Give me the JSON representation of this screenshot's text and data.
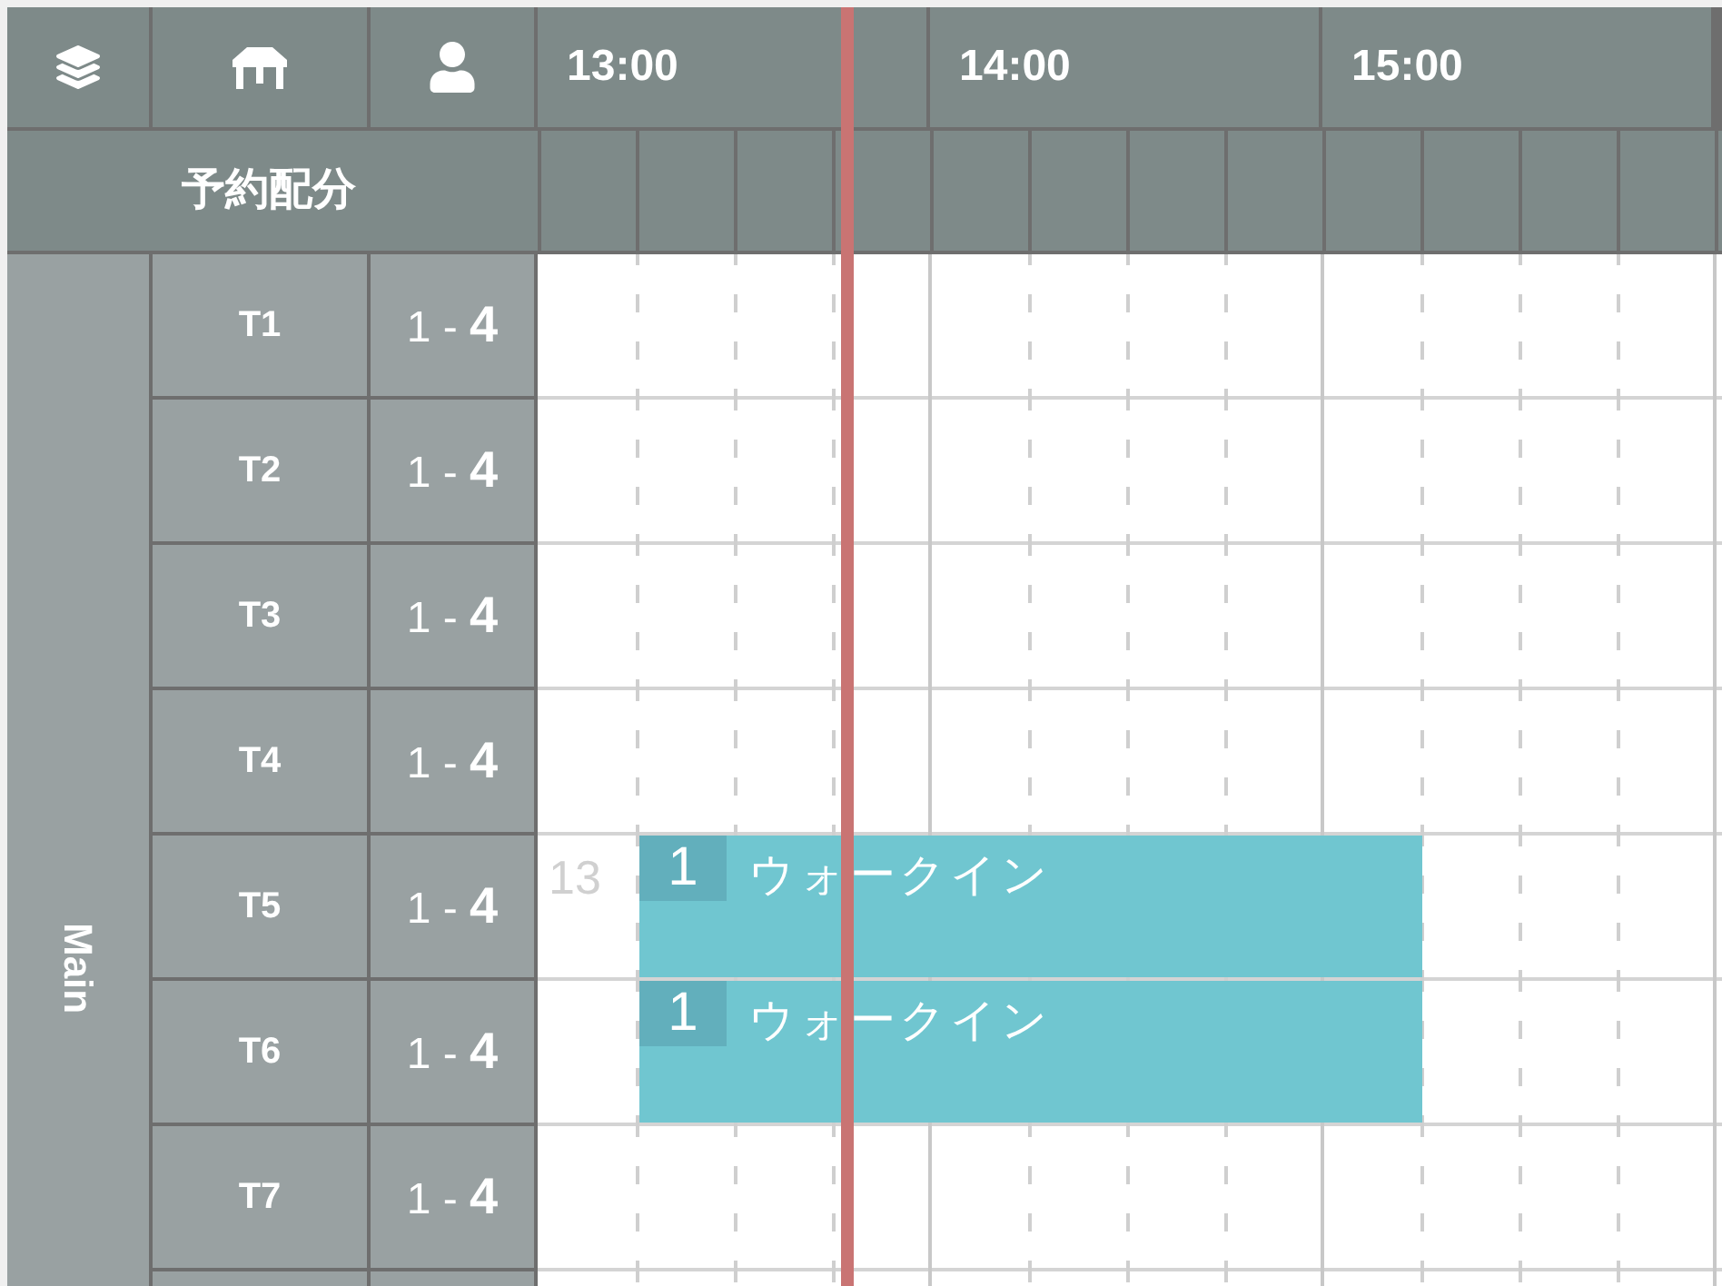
{
  "header": {
    "hours": [
      "13:00",
      "14:00",
      "15:00"
    ]
  },
  "subheader": {
    "title": "予約配分"
  },
  "section": {
    "name": "Main"
  },
  "rows": [
    {
      "table": "T1",
      "capacity": "1 - **4**"
    },
    {
      "table": "T2",
      "capacity": "1 - **4**"
    },
    {
      "table": "T3",
      "capacity": "1 - **4**"
    },
    {
      "table": "T4",
      "capacity": "1 - **4**"
    },
    {
      "table": "T5",
      "capacity": "1 - **4**",
      "marker": "13",
      "booking": {
        "count": "1",
        "label": "ウォークイン"
      }
    },
    {
      "table": "T6",
      "capacity": "1 - **4**",
      "booking": {
        "count": "1",
        "label": "ウォークイン"
      }
    },
    {
      "table": "T7",
      "capacity": "1 - **4**"
    }
  ]
}
